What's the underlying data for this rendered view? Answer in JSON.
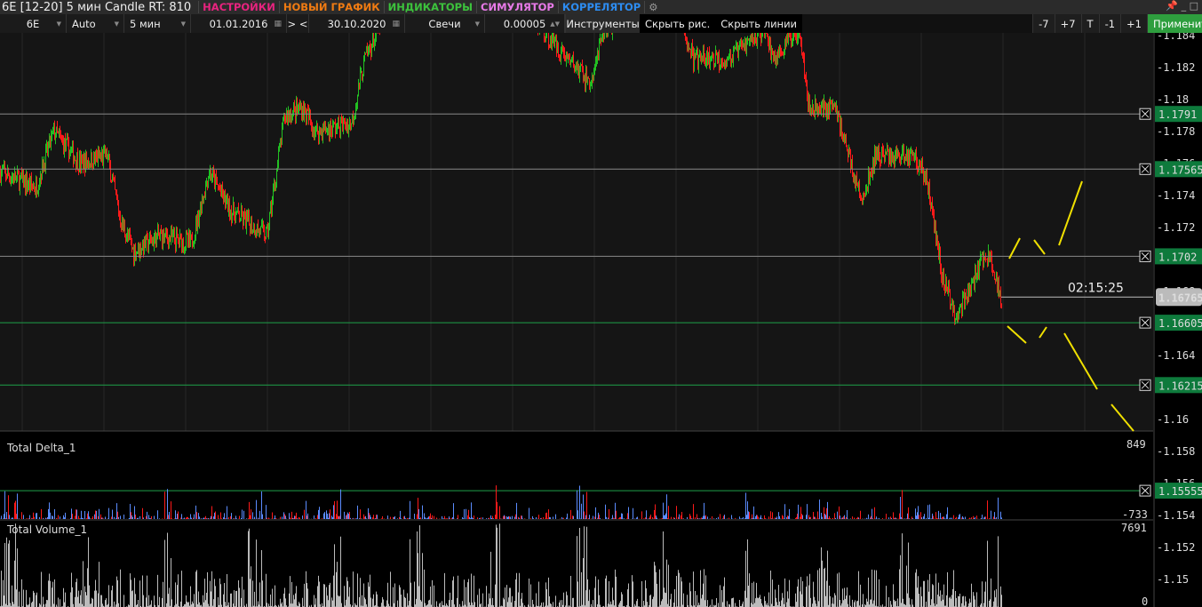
{
  "title": "6E [12-20] 5 мин Candle RT: 810",
  "menu": [
    {
      "label": "НАСТРОЙКИ",
      "color": "#e8237f"
    },
    {
      "label": "НОВЫЙ ГРАФИК",
      "color": "#f07b12"
    },
    {
      "label": "ИНДИКАТОРЫ",
      "color": "#3cc23c"
    },
    {
      "label": "СИМУЛЯТОР",
      "color": "#e87ae8"
    },
    {
      "label": "КОРРЕЛЯТОР",
      "color": "#2d8cf0"
    }
  ],
  "toolbar": {
    "symbol": "6E",
    "mode": "Auto",
    "timeframe": "5 мин",
    "date_from": "01.01.2016",
    "nav": "> <",
    "date_to": "30.10.2020",
    "chart_type": "Свечи",
    "tick": "0.00005",
    "instruments": "Инструменты",
    "hide_drawings": "Скрыть рис.",
    "hide_lines": "Скрыть линии",
    "shift_buttons": [
      "-7",
      "+7",
      "T",
      "-1",
      "+1"
    ],
    "apply": "Применить"
  },
  "axis": {
    "ticks": [
      "1.184",
      "1.182",
      "1.18",
      "1.178",
      "1.176",
      "1.174",
      "1.172",
      "1.17",
      "1.168",
      "1.166",
      "1.164",
      "1.162",
      "1.16",
      "1.158",
      "1.156",
      "1.154",
      "1.152",
      "1.15"
    ]
  },
  "levels": [
    {
      "price": "1.1791",
      "color": "#888"
    },
    {
      "price": "1.17565",
      "color": "#888"
    },
    {
      "price": "1.1702",
      "color": "#888"
    },
    {
      "price": "1.16605",
      "color": "#1fa04a"
    },
    {
      "price": "1.16215",
      "color": "#1fa04a"
    },
    {
      "price": "1.15555",
      "color": "#1fa04a"
    }
  ],
  "current": {
    "price": "1.16765",
    "timer": "02:15:25"
  },
  "price_path": [
    [
      0,
      1.1755
    ],
    [
      40,
      1.1745
    ],
    [
      60,
      1.178
    ],
    [
      90,
      1.176
    ],
    [
      120,
      1.1765
    ],
    [
      135,
      1.1725
    ],
    [
      150,
      1.1705
    ],
    [
      180,
      1.1715
    ],
    [
      215,
      1.171
    ],
    [
      235,
      1.1755
    ],
    [
      260,
      1.173
    ],
    [
      300,
      1.1715
    ],
    [
      320,
      1.179
    ],
    [
      340,
      1.1795
    ],
    [
      355,
      1.178
    ],
    [
      395,
      1.1785
    ],
    [
      410,
      1.1825
    ],
    [
      430,
      1.185
    ],
    [
      460,
      1.186
    ],
    [
      600,
      1.185
    ],
    [
      640,
      1.1825
    ],
    [
      665,
      1.181
    ],
    [
      680,
      1.1845
    ],
    [
      760,
      1.186
    ],
    [
      780,
      1.1825
    ],
    [
      820,
      1.1825
    ],
    [
      860,
      1.1845
    ],
    [
      870,
      1.1825
    ],
    [
      900,
      1.1845
    ],
    [
      910,
      1.1795
    ],
    [
      940,
      1.1795
    ],
    [
      955,
      1.1765
    ],
    [
      970,
      1.1735
    ],
    [
      985,
      1.1765
    ],
    [
      1030,
      1.1765
    ],
    [
      1045,
      1.1745
    ],
    [
      1060,
      1.169
    ],
    [
      1075,
      1.1665
    ],
    [
      1090,
      1.168
    ],
    [
      1110,
      1.1705
    ],
    [
      1127,
      1.16765
    ]
  ],
  "delta": {
    "label": "Total Delta_1",
    "max": "849",
    "min": "-733"
  },
  "volume": {
    "label": "Total Volume_1",
    "max": "7691",
    "min": "0"
  },
  "colors": {
    "up": "#22c022",
    "down": "#ff1a1a",
    "delta_pos": "#5b8cff",
    "delta_neg": "#ff1a1a",
    "volume": "#bbbbbb",
    "drawing": "#f0e000"
  }
}
